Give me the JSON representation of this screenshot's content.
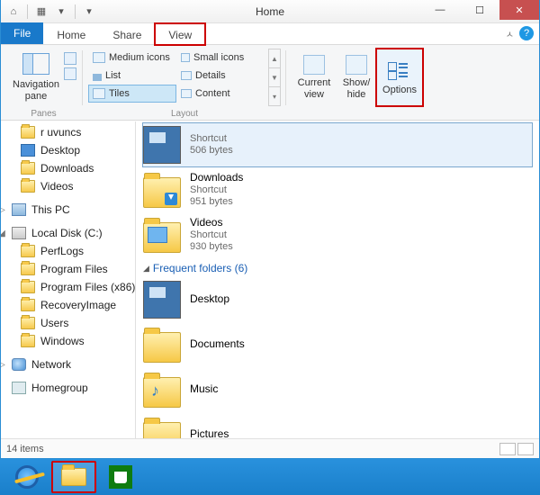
{
  "title": "Home",
  "tabs": {
    "file": "File",
    "home": "Home",
    "share": "Share",
    "view": "View"
  },
  "ribbon": {
    "panes_label": "Panes",
    "layout_label": "Layout",
    "navpane": "Navigation pane",
    "medium": "Medium icons",
    "small": "Small icons",
    "list": "List",
    "details": "Details",
    "tiles": "Tiles",
    "content": "Content",
    "current_view": "Current view",
    "show_hide": "Show/ hide",
    "options": "Options"
  },
  "nav": {
    "fav_trunc": "r uvuncs",
    "desktop": "Desktop",
    "downloads": "Downloads",
    "videos": "Videos",
    "thispc": "This PC",
    "localdisk": "Local Disk (C:)",
    "perflogs": "PerfLogs",
    "progfiles": "Program Files",
    "progfiles86": "Program Files (x86)",
    "recovery": "RecoveryImage",
    "users": "Users",
    "windows": "Windows",
    "network": "Network",
    "homegroup": "Homegroup"
  },
  "content": {
    "shortcut": "Shortcut",
    "s1": {
      "name": "",
      "size": "506 bytes"
    },
    "s2": {
      "name": "Downloads",
      "size": "951 bytes"
    },
    "s3": {
      "name": "Videos",
      "size": "930 bytes"
    },
    "freq_header": "Frequent folders (6)",
    "f1": "Desktop",
    "f2": "Documents",
    "f3": "Music",
    "f4": "Pictures"
  },
  "status": {
    "count": "14 items"
  }
}
